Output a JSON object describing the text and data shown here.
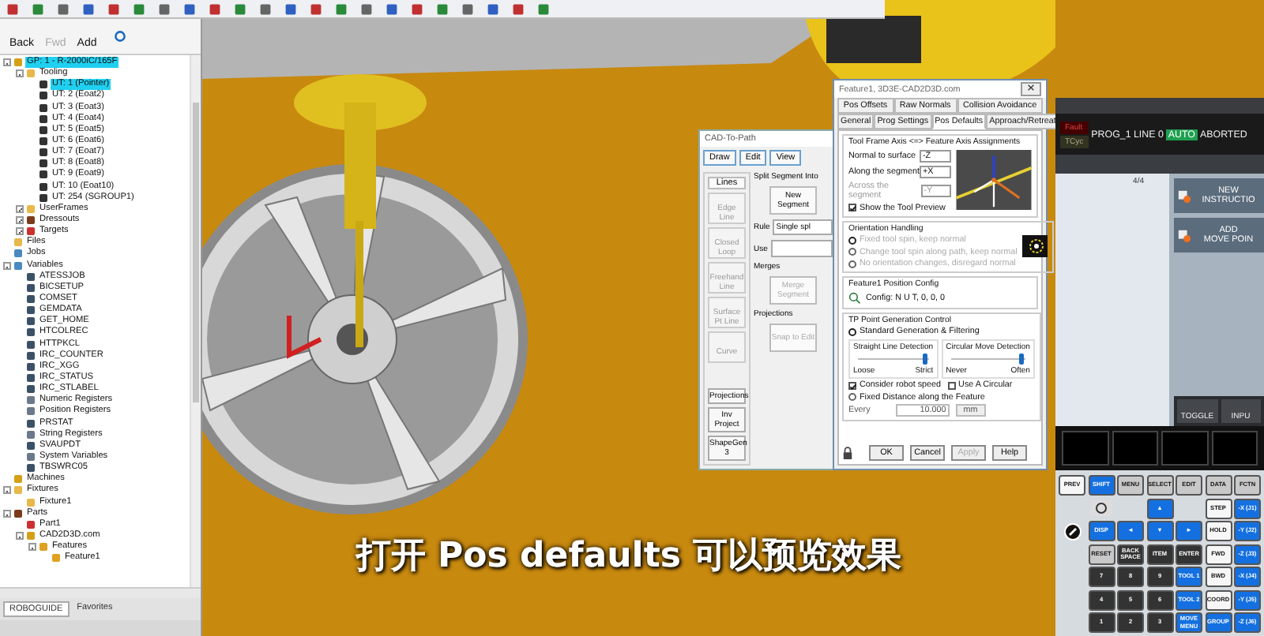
{
  "left_panel": {
    "nav_buttons": [
      {
        "label": "Back",
        "disabled": false
      },
      {
        "label": "Fwd",
        "disabled": true
      },
      {
        "label": "Add",
        "disabled": false
      }
    ],
    "tree": [
      {
        "label": "GP: 1 - R-2000iC/165F",
        "kind": "robot",
        "selected": true,
        "expanded": true,
        "children": [
          {
            "label": "Tooling",
            "kind": "folder",
            "selected": false,
            "expanded": true,
            "children": [
              {
                "label": "UT: 1 (Pointer)",
                "kind": "tool",
                "selected": true
              },
              {
                "label": "UT: 2 (Eoat2)",
                "kind": "tool",
                "selected": false
              },
              {
                "label": "UT: 3 (Eoat3)",
                "kind": "tool",
                "selected": false
              },
              {
                "label": "UT: 4 (Eoat4)",
                "kind": "tool",
                "selected": false
              },
              {
                "label": "UT: 5 (Eoat5)",
                "kind": "tool",
                "selected": false
              },
              {
                "label": "UT: 6 (Eoat6)",
                "kind": "tool",
                "selected": false
              },
              {
                "label": "UT: 7 (Eoat7)",
                "kind": "tool",
                "selected": false
              },
              {
                "label": "UT: 8 (Eoat8)",
                "kind": "tool",
                "selected": false
              },
              {
                "label": "UT: 9 (Eoat9)",
                "kind": "tool",
                "selected": false
              },
              {
                "label": "UT: 10 (Eoat10)",
                "kind": "tool",
                "selected": false
              },
              {
                "label": "UT: 254 (SGROUP1)",
                "kind": "tool",
                "selected": false
              }
            ]
          },
          {
            "label": "UserFrames",
            "kind": "folder",
            "selected": false,
            "expanded": false
          },
          {
            "label": "Dressouts",
            "kind": "part",
            "selected": false,
            "expanded": false
          },
          {
            "label": "Targets",
            "kind": "target",
            "selected": false,
            "expanded": false
          }
        ]
      },
      {
        "label": "Files",
        "kind": "folder",
        "selected": false
      },
      {
        "label": "Jobs",
        "kind": "file",
        "selected": false
      },
      {
        "label": "Variables",
        "kind": "file",
        "selected": false,
        "expanded": true,
        "children": [
          {
            "label": "ATESSJOB",
            "kind": "var",
            "selected": false
          },
          {
            "label": "BICSETUP",
            "kind": "var",
            "selected": false
          },
          {
            "label": "COMSET",
            "kind": "var",
            "selected": false
          },
          {
            "label": "GEMDATA",
            "kind": "var",
            "selected": false
          },
          {
            "label": "GET_HOME",
            "kind": "var",
            "selected": false
          },
          {
            "label": "HTCOLREC",
            "kind": "var",
            "selected": false
          },
          {
            "label": "HTTPKCL",
            "kind": "var",
            "selected": false
          },
          {
            "label": "IRC_COUNTER",
            "kind": "var",
            "selected": false
          },
          {
            "label": "IRC_XGG",
            "kind": "var",
            "selected": false
          },
          {
            "label": "IRC_STATUS",
            "kind": "var",
            "selected": false
          },
          {
            "label": "IRC_STLABEL",
            "kind": "var",
            "selected": false
          },
          {
            "label": "Numeric Registers",
            "kind": "reg",
            "selected": false
          },
          {
            "label": "Position Registers",
            "kind": "reg",
            "selected": false
          },
          {
            "label": "PRSTAT",
            "kind": "var",
            "selected": false
          },
          {
            "label": "String Registers",
            "kind": "reg",
            "selected": false
          },
          {
            "label": "SVAUPDT",
            "kind": "var",
            "selected": false
          },
          {
            "label": "System Variables",
            "kind": "reg",
            "selected": false
          },
          {
            "label": "TBSWRC05",
            "kind": "var",
            "selected": false
          }
        ]
      },
      {
        "label": "Machines",
        "kind": "robot",
        "selected": false
      },
      {
        "label": "Fixtures",
        "kind": "folder",
        "selected": false,
        "expanded": true,
        "children": [
          {
            "label": "Fixture1",
            "kind": "folder",
            "selected": false
          }
        ]
      },
      {
        "label": "Parts",
        "kind": "part",
        "selected": false,
        "expanded": true,
        "children": [
          {
            "label": "Part1",
            "kind": "target",
            "selected": false
          },
          {
            "label": "CAD2D3D.com",
            "kind": "robot",
            "selected": false,
            "expanded": true,
            "children": [
              {
                "label": "Features",
                "kind": "feature",
                "selected": false,
                "expanded": true,
                "children": [
                  {
                    "label": "Feature1",
                    "kind": "feature",
                    "selected": false
                  }
                ]
              }
            ]
          }
        ]
      }
    ],
    "tabs": [
      {
        "label": "ROBOGUIDE",
        "selected": true
      },
      {
        "label": "Favorites",
        "selected": false
      }
    ]
  },
  "cad_to_path": {
    "title": "CAD-To-Path",
    "menus": [
      "Draw",
      "Edit",
      "View"
    ],
    "tools_header": "Lines",
    "tools": [
      "Edge Line",
      "Closed Loop",
      "Freehand Line",
      "Surface Pt Line",
      "Curve"
    ],
    "bottom_buttons": [
      "Projections",
      "Inv Project",
      "ShapeGen 3"
    ],
    "split_label": "Split Segment Into",
    "new_segment": "New Segment",
    "rule_label": "Rule",
    "rule_value": "Single spl",
    "use_label": "Use",
    "merges_label": "Merges",
    "merge_button": "Merge Segment",
    "projections_label": "Projections",
    "snap_button": "Snap to Edit"
  },
  "feature_dialog": {
    "title": "Feature1, 3D3E-CAD2D3D.com",
    "tab_rows": [
      [
        {
          "label": "Pos Offsets",
          "selected": false
        },
        {
          "label": "Raw Normals",
          "selected": false
        },
        {
          "label": "Collision Avoidance",
          "selected": false
        }
      ],
      [
        {
          "label": "General",
          "selected": false
        },
        {
          "label": "Prog Settings",
          "selected": false
        },
        {
          "label": "Pos Defaults",
          "selected": true
        },
        {
          "label": "Approach/Retreat",
          "selected": false
        }
      ]
    ],
    "axis_group": {
      "legend": "Tool Frame Axis <=> Feature Axis Assignments",
      "fields": [
        {
          "label": "Normal to surface",
          "value": "-Z",
          "disabled": false
        },
        {
          "label": "Along the segment",
          "value": "+X",
          "disabled": false
        },
        {
          "label": "Across the segment",
          "value": "-Y",
          "disabled": true
        }
      ],
      "show_preview": {
        "label": "Show the Tool Preview",
        "checked": true
      }
    },
    "orientation": {
      "legend": "Orientation Handling",
      "disabled": true,
      "options": [
        {
          "label": "Fixed tool spin, keep normal",
          "selected": true
        },
        {
          "label": "Change tool spin along path, keep normal",
          "selected": false
        },
        {
          "label": "No orientation changes, disregard normal",
          "selected": false
        }
      ]
    },
    "position_config": {
      "legend": "Feature1 Position Config",
      "value": "Config: N U T, 0, 0, 0"
    },
    "tp": {
      "legend": "TP Point Generation Control",
      "modes": [
        {
          "label": "Standard Generation & Filtering",
          "selected": true
        },
        {
          "label": "Fixed Distance along the Feature",
          "selected": false
        }
      ],
      "sliders": [
        {
          "title": "Straight Line Detection",
          "min_label": "Loose",
          "max_label": "Strict",
          "level": 0.95
        },
        {
          "title": "Circular Move Detection",
          "min_label": "Never",
          "max_label": "Often",
          "level": 0.95
        }
      ],
      "checks": [
        {
          "label": "Consider robot speed",
          "checked": true
        },
        {
          "label": "Use A Circular",
          "checked": false
        }
      ],
      "every": {
        "label": "Every",
        "value": "10.000",
        "unit": "mm",
        "disabled": true
      }
    },
    "buttons": [
      {
        "label": "OK",
        "disabled": false
      },
      {
        "label": "Cancel",
        "disabled": false
      },
      {
        "label": "Apply",
        "disabled": true
      },
      {
        "label": "Help",
        "disabled": false
      }
    ]
  },
  "pendant": {
    "status": {
      "fault": "Fault",
      "tcyc": "TCyc",
      "program": "PROG_1 LINE 0",
      "mode": "AUTO",
      "state": "ABORTED"
    },
    "page": "4/4",
    "actions": [
      {
        "lines": [
          "NEW",
          "INSTRUCTIO"
        ]
      },
      {
        "lines": [
          "ADD",
          "MOVE POIN"
        ]
      }
    ],
    "softkeys": [
      "TOGGLE",
      "INPU"
    ],
    "keypad": [
      [
        {
          "label": "PREV",
          "kind": "white"
        },
        {
          "label": "SHIFT",
          "kind": "blue"
        },
        {
          "label": "MENU",
          "kind": "gray"
        },
        {
          "label": "SELECT",
          "kind": "gray"
        },
        {
          "label": "EDIT",
          "kind": "gray"
        },
        {
          "label": "DATA",
          "kind": "gray"
        },
        {
          "label": "FCTN",
          "kind": "gray"
        }
      ],
      [
        {
          "kind": "gap"
        },
        {
          "kind": "info"
        },
        {
          "kind": "gap"
        },
        {
          "label": "▲",
          "kind": "blue"
        },
        {
          "kind": "gap"
        },
        {
          "label": "STEP",
          "kind": "white"
        },
        {
          "label": "-X (J1)",
          "kind": "blue"
        }
      ],
      [
        {
          "kind": "dial"
        },
        {
          "label": "DISP",
          "kind": "blue"
        },
        {
          "label": "◄",
          "kind": "blue"
        },
        {
          "label": "▼",
          "kind": "blue"
        },
        {
          "label": "►",
          "kind": "blue"
        },
        {
          "label": "HOLD",
          "kind": "white"
        },
        {
          "label": "-Y (J2)",
          "kind": "blue"
        }
      ],
      [
        {
          "kind": "gap"
        },
        {
          "label": "RESET",
          "kind": "gray"
        },
        {
          "label": "BACK SPACE",
          "kind": "dark"
        },
        {
          "label": "ITEM",
          "kind": "dark"
        },
        {
          "label": "ENTER",
          "kind": "dark"
        },
        {
          "label": "FWD",
          "kind": "white"
        },
        {
          "label": "-Z (J3)",
          "kind": "blue"
        }
      ],
      [
        {
          "kind": "gap"
        },
        {
          "label": "7",
          "kind": "dark"
        },
        {
          "label": "8",
          "kind": "dark"
        },
        {
          "label": "9",
          "kind": "dark"
        },
        {
          "label": "TOOL 1",
          "kind": "blue"
        },
        {
          "label": "BWD",
          "kind": "white"
        },
        {
          "label": "-X (J4)",
          "kind": "blue"
        }
      ],
      [
        {
          "kind": "gap"
        },
        {
          "label": "4",
          "kind": "dark"
        },
        {
          "label": "5",
          "kind": "dark"
        },
        {
          "label": "6",
          "kind": "dark"
        },
        {
          "label": "TOOL 2",
          "kind": "blue"
        },
        {
          "label": "COORD",
          "kind": "white"
        },
        {
          "label": "-Y (J5)",
          "kind": "blue"
        }
      ],
      [
        {
          "kind": "gap"
        },
        {
          "label": "1",
          "kind": "dark"
        },
        {
          "label": "2",
          "kind": "dark"
        },
        {
          "label": "3",
          "kind": "dark"
        },
        {
          "label": "MOVE MENU",
          "kind": "blue"
        },
        {
          "label": "GROUP",
          "kind": "blue"
        },
        {
          "label": "-Z (J6)",
          "kind": "blue"
        }
      ]
    ]
  },
  "subtitle": "打开 Pos defaults 可以预览效果"
}
